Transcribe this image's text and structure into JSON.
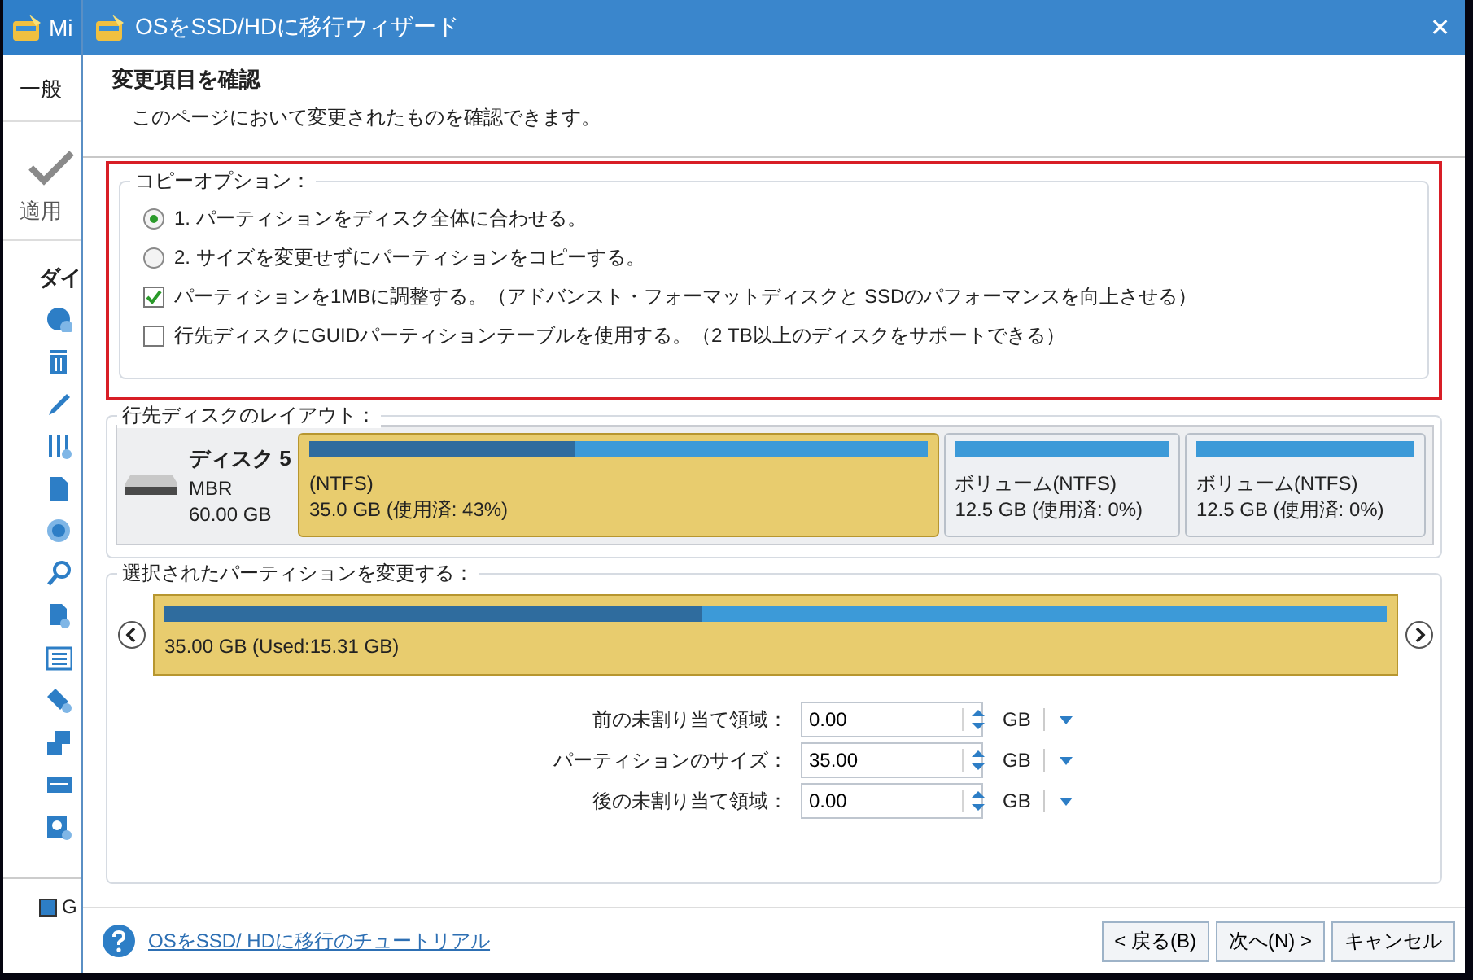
{
  "background_app": {
    "title": "Mi",
    "menu": "一般",
    "apply_label": "適用",
    "section_title": "ダイ",
    "legend_label": "G"
  },
  "window": {
    "title": "OSをSSD/HDに移行ウィザード",
    "close": "✕"
  },
  "header": {
    "title": "変更項目を確認",
    "subtitle": "このページにおいて変更されたものを確認できます。"
  },
  "copy_options": {
    "title": "コピーオプション：",
    "options": [
      {
        "kind": "radio",
        "label": "1. パーティションをディスク全体に合わせる。",
        "selected": true
      },
      {
        "kind": "radio",
        "label": "2. サイズを変更せずにパーティションをコピーする。",
        "selected": false
      },
      {
        "kind": "checkbox",
        "label": "パーティションを1MBに調整する。（アドバンスト・フォーマットディスクと SSDのパフォーマンスを向上させる）",
        "checked": true
      },
      {
        "kind": "checkbox",
        "label": "行先ディスクにGUIDパーティションテーブルを使用する。（2 TB以上のディスクをサポートできる）",
        "checked": false
      }
    ]
  },
  "disk_layout": {
    "title": "行先ディスクのレイアウト：",
    "disk": {
      "name": "ディスク 5",
      "type": "MBR",
      "size": "60.00 GB"
    },
    "partitions": [
      {
        "label": "(NTFS)",
        "detail": "35.0 GB (使用済: 43%)",
        "level": 0.43,
        "selected": true
      },
      {
        "label": "ボリューム(NTFS)",
        "detail": "12.5 GB (使用済: 0%)",
        "level": 0,
        "selected": false
      },
      {
        "label": "ボリューム(NTFS)",
        "detail": "12.5 GB (使用済: 0%)",
        "level": 0,
        "selected": false
      }
    ]
  },
  "resize": {
    "title": "選択されたパーティションを変更する：",
    "bar": {
      "label": "35.00 GB (Used:15.31 GB)",
      "level": 0.44
    },
    "fields": [
      {
        "label": "前の未割り当て領域：",
        "value": "0.00",
        "unit": "GB"
      },
      {
        "label": "パーティションのサイズ：",
        "value": "35.00",
        "unit": "GB"
      },
      {
        "label": "後の未割り当て領域：",
        "value": "0.00",
        "unit": "GB"
      }
    ]
  },
  "footer": {
    "help_link": "OSをSSD/ HDに移行のチュートリアル",
    "buttons": [
      "< 戻る(B)",
      "次へ(N) >",
      "キャンセル"
    ]
  }
}
